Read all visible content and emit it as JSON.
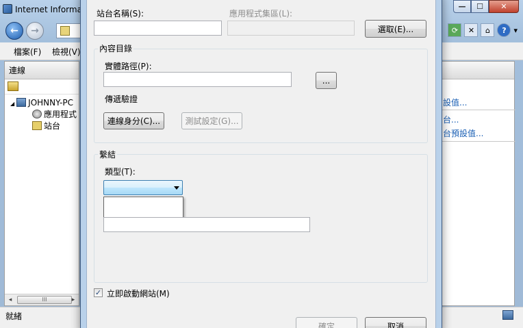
{
  "window": {
    "title": "Internet Informa",
    "min_glyph": "—",
    "max_glyph": "☐",
    "close_glyph": "✕"
  },
  "nav": {
    "back_glyph": "←",
    "forward_glyph": "→"
  },
  "toolbar_icons": {
    "refresh": "⟳",
    "stop": "✕",
    "home": "⌂",
    "help": "?",
    "help_dropdown": "▾"
  },
  "menu": {
    "items": [
      "檔案(F)",
      "檢視(V)"
    ]
  },
  "connections": {
    "header": "連線",
    "tree": [
      {
        "expander": "◢",
        "label": "JOHNNY-PC"
      },
      {
        "label": "應用程式"
      },
      {
        "label": "站台"
      }
    ],
    "scroll_left": "◂",
    "scroll_thumb": "III",
    "scroll_right": "▸"
  },
  "actions": {
    "links": [
      "設值...",
      "台...",
      "台預設值..."
    ]
  },
  "status": {
    "text": "就緒"
  },
  "dialog": {
    "site_name_label": "站台名稱(S):",
    "site_name_value": "",
    "app_pool_label": "應用程式集區(L):",
    "app_pool_value": "",
    "select_button": "選取(E)...",
    "content_dir_group": "內容目錄",
    "physical_path_label": "實體路徑(P):",
    "physical_path_value": "",
    "browse_button": "...",
    "pass_through_label": "傳遞驗證",
    "connect_as_button": "連線身分(C)...",
    "test_settings_button": "測試設定(G)...",
    "binding_group": "繫結",
    "type_label": "類型(T):",
    "type_value": "",
    "host_value": "",
    "start_checkbox_label": "立即啟動網站(M)",
    "start_checked": true,
    "check_glyph": "✓",
    "ok_button": "確定",
    "cancel_button": "取消"
  }
}
